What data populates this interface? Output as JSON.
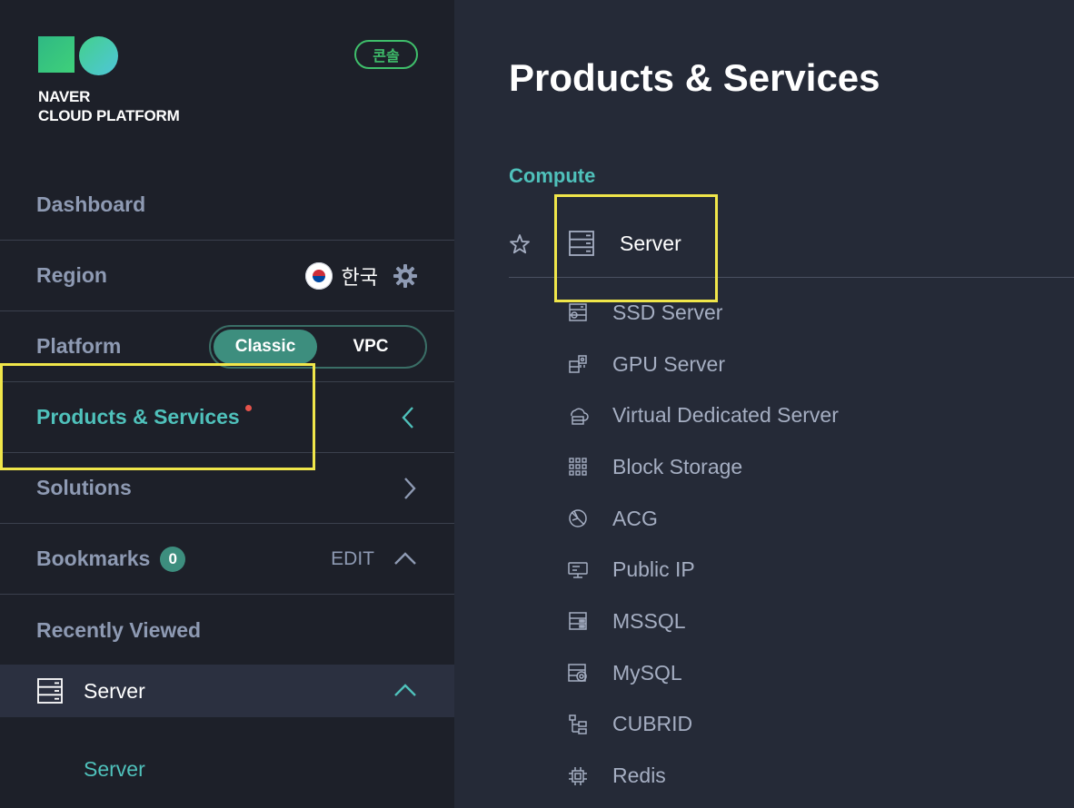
{
  "brand": {
    "line1": "NAVER",
    "line2": "CLOUD PLATFORM",
    "console_badge": "콘솔"
  },
  "sidebar": {
    "dashboard": "Dashboard",
    "region": {
      "label": "Region",
      "value": "한국"
    },
    "platform": {
      "label": "Platform",
      "options": [
        "Classic",
        "VPC"
      ],
      "selected": "Classic"
    },
    "products": "Products & Services",
    "solutions": "Solutions",
    "bookmarks": {
      "label": "Bookmarks",
      "count": "0",
      "edit": "EDIT"
    },
    "recently_viewed": {
      "label": "Recently Viewed",
      "item": "Server",
      "sub_item": "Server"
    }
  },
  "main": {
    "title": "Products & Services",
    "section": "Compute",
    "server": "Server",
    "sub_items": [
      {
        "label": "SSD Server",
        "icon": "ssd-server-icon"
      },
      {
        "label": "GPU Server",
        "icon": "gpu-server-icon"
      },
      {
        "label": "Virtual Dedicated Server",
        "icon": "cloud-server-icon"
      },
      {
        "label": "Block Storage",
        "icon": "grid-icon"
      },
      {
        "label": "ACG",
        "icon": "shield-icon"
      },
      {
        "label": "Public IP",
        "icon": "monitor-icon"
      },
      {
        "label": "MSSQL",
        "icon": "database-icon"
      },
      {
        "label": "MySQL",
        "icon": "database-disk-icon"
      },
      {
        "label": "CUBRID",
        "icon": "tree-icon"
      },
      {
        "label": "Redis",
        "icon": "chip-icon"
      }
    ]
  },
  "colors": {
    "accent": "#4fc1bb",
    "highlight": "#f0e64a",
    "badge_green": "#3fbf6b",
    "toggle_bg": "#3d8e7e"
  }
}
